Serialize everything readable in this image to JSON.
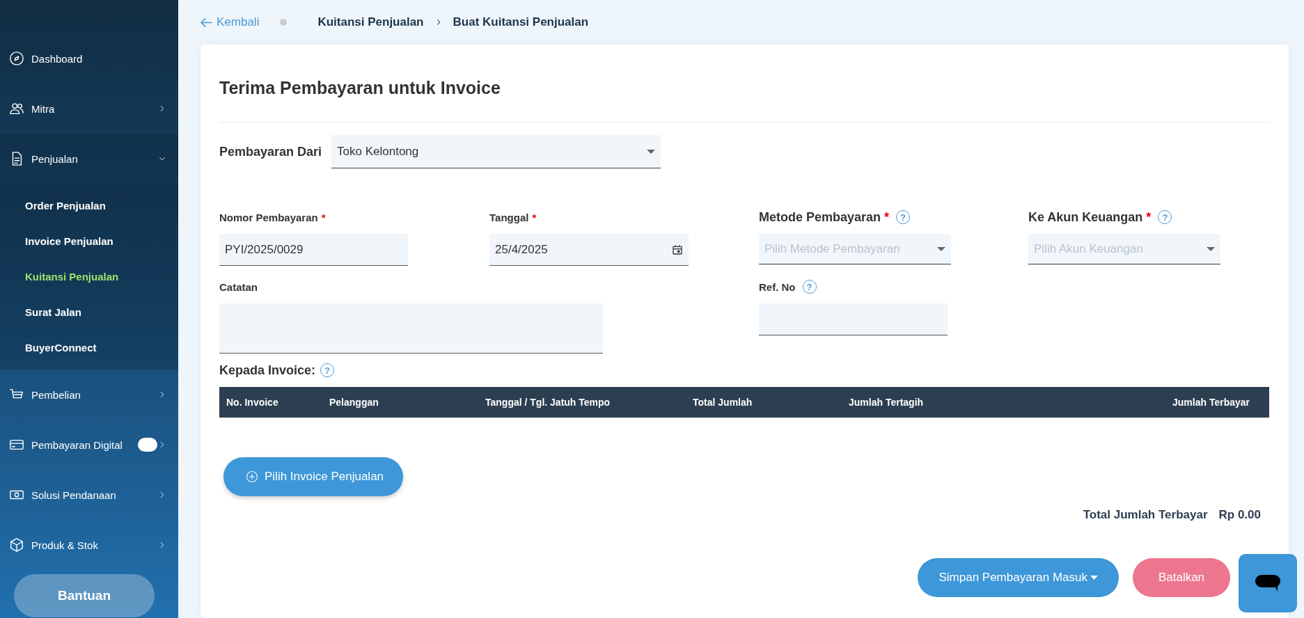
{
  "sidebar": {
    "items": [
      {
        "label": "Dashboard",
        "kind": "link"
      },
      {
        "label": "Mitra",
        "kind": "menu",
        "expanded": false
      },
      {
        "label": "Penjualan",
        "kind": "menu",
        "expanded": true,
        "children": [
          {
            "label": "Order Penjualan",
            "selected": false
          },
          {
            "label": "Invoice Penjualan",
            "selected": false
          },
          {
            "label": "Kuitansi Penjualan",
            "selected": true
          },
          {
            "label": "Surat Jalan",
            "selected": false
          },
          {
            "label": "BuyerConnect",
            "selected": false
          }
        ]
      },
      {
        "label": "Pembelian",
        "kind": "menu",
        "expanded": false
      },
      {
        "label": "Pembayaran Digital",
        "kind": "menu",
        "expanded": false,
        "toggle": true
      },
      {
        "label": "Solusi Pendanaan",
        "kind": "menu",
        "expanded": false
      },
      {
        "label": "Produk & Stok",
        "kind": "menu",
        "expanded": false
      }
    ],
    "help_button": "Bantuan"
  },
  "breadcrumb": {
    "back": "Kembali",
    "items": [
      "Kuitansi Penjualan",
      "Buat Kuitansi Penjualan"
    ]
  },
  "form": {
    "title": "Terima Pembayaran untuk Invoice",
    "payment_from": {
      "label": "Pembayaran Dari",
      "value": "Toko Kelontong"
    },
    "payment_number": {
      "label": "Nomor Pembayaran",
      "required_mark": "*",
      "value": "PYI/2025/0029"
    },
    "date": {
      "label": "Tanggal",
      "required_mark": "*",
      "value": "25/4/2025"
    },
    "payment_method": {
      "label": "Metode Pembayaran",
      "required_mark": "*",
      "help": "?",
      "placeholder": "Pilih Metode Pembayaran"
    },
    "account": {
      "label": "Ke Akun Keuangan",
      "required_mark": "*",
      "help": "?",
      "placeholder": "Pilih Akun Keuangan"
    },
    "note": {
      "label": "Catatan"
    },
    "ref_no": {
      "label": "Ref. No",
      "help": "?"
    },
    "invoices_label": "Kepada Invoice:",
    "invoices_help": "?",
    "table": {
      "columns": [
        "No. Invoice",
        "Pelanggan",
        "Tanggal / Tgl. Jatuh Tempo",
        "Total Jumlah",
        "Jumlah Tertagih",
        "Jumlah Terbayar"
      ]
    },
    "add_invoice_button": "Pilih Invoice Penjualan",
    "total_label": "Total Jumlah Terbayar",
    "total_value": "Rp 0.00",
    "save_button": "Simpan Pembayaran Masuk",
    "cancel_button": "Batalkan"
  }
}
